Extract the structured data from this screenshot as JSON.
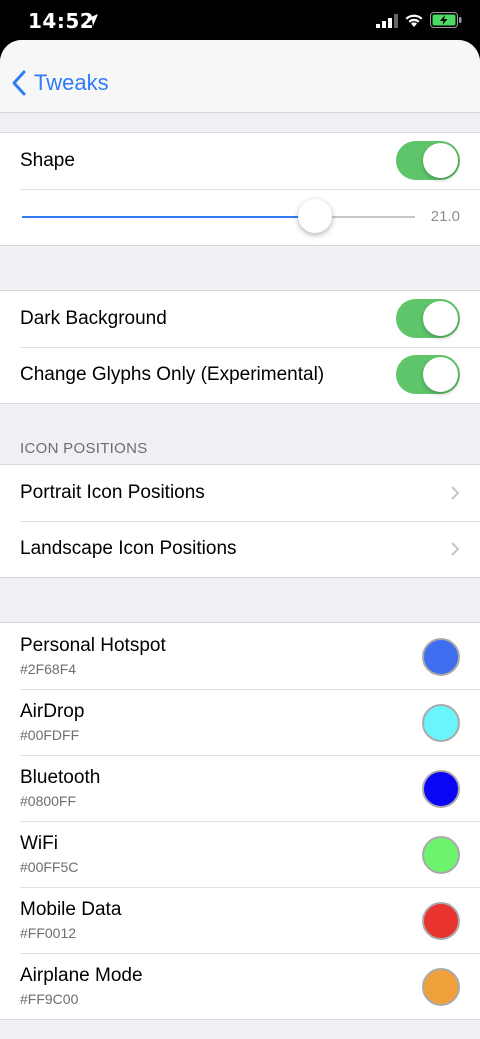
{
  "status_bar": {
    "time": "14:52"
  },
  "nav": {
    "back_label": "Tweaks"
  },
  "shape_group": {
    "shape_label": "Shape",
    "shape_on": true,
    "slider_value_text": "21.0",
    "slider_fraction": 0.745
  },
  "appearance_group": {
    "dark_background_label": "Dark Background",
    "dark_background_on": true,
    "glyphs_only_label": "Change Glyphs Only (Experimental)",
    "glyphs_only_on": true
  },
  "icon_positions": {
    "header": "ICON POSITIONS",
    "portrait_label": "Portrait Icon Positions",
    "landscape_label": "Landscape Icon Positions"
  },
  "colors": [
    {
      "name": "Personal Hotspot",
      "hex": "#2F68F4",
      "swatch": "#3f6ef0"
    },
    {
      "name": "AirDrop",
      "hex": "#00FDFF",
      "swatch": "#6af4fb"
    },
    {
      "name": "Bluetooth",
      "hex": "#0800FF",
      "swatch": "#0a05f5"
    },
    {
      "name": "WiFi",
      "hex": "#00FF5C",
      "swatch": "#6cf56c"
    },
    {
      "name": "Mobile Data",
      "hex": "#FF0012",
      "swatch": "#e8332e"
    },
    {
      "name": "Airplane Mode",
      "hex": "#FF9C00",
      "swatch": "#f0a03a"
    }
  ],
  "accent": "#2f7cf6",
  "toggle_color": "#5fc56a"
}
